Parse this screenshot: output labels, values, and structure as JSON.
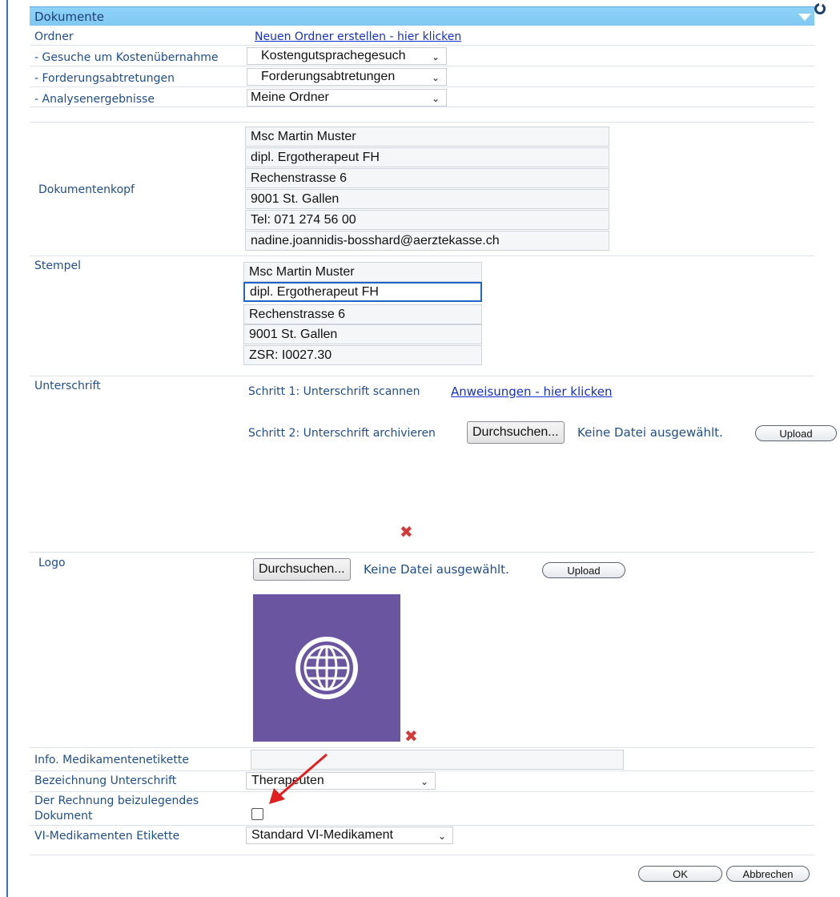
{
  "panel": {
    "title": "Dokumente"
  },
  "folders": {
    "label": "Ordner",
    "create_link": "Neuen Ordner erstellen - hier klicken",
    "rows": [
      {
        "label": "- Gesuche um Kostenübernahme",
        "value": "Kostengutsprachegesuch"
      },
      {
        "label": "- Forderungsabtretungen",
        "value": "Forderungsabtretungen"
      },
      {
        "label": "- Analysenergebnisse",
        "value": "Meine Ordner"
      }
    ]
  },
  "header_doc": {
    "label": "Dokumentenkopf",
    "lines": [
      "Msc Martin Muster",
      "dipl. Ergotherapeut FH",
      "Rechenstrasse 6",
      "9001 St. Gallen",
      "Tel: 071 274 56 00",
      "nadine.joannidis-bosshard@aerztekasse.ch"
    ]
  },
  "stamp": {
    "label": "Stempel",
    "lines": [
      "Msc Martin Muster",
      "dipl. Ergotherapeut FH",
      "Rechenstrasse 6",
      "9001 St. Gallen",
      "ZSR: I0027.30"
    ]
  },
  "signature": {
    "label": "Unterschrift",
    "step1_text": "Schritt 1: Unterschrift scannen",
    "step1_link": "Anweisungen - hier klicken",
    "step2_text": "Schritt 2: Unterschrift archivieren",
    "browse_label": "Durchsuchen...",
    "no_file": "Keine Datei ausgewählt.",
    "upload_label": "Upload"
  },
  "logo": {
    "label": "Logo",
    "browse_label": "Durchsuchen...",
    "no_file": "Keine Datei ausgewählt.",
    "upload_label": "Upload",
    "image_icon": "globe-icon",
    "image_color": "#6a55a0"
  },
  "medication_label_info": {
    "label": "Info. Medikamentenetikette",
    "value": ""
  },
  "signature_designation": {
    "label": "Bezeichnung Unterschrift",
    "value": "Therapeuten"
  },
  "invoice_document": {
    "label_line1": "Der Rechnung beizulegendes",
    "label_line2": "Dokument",
    "checked": false
  },
  "vi_label": {
    "label": "VI-Medikamenten Etikette",
    "value": "Standard VI-Medikament"
  },
  "actions": {
    "ok_label": "OK",
    "cancel_label": "Abbrechen"
  },
  "colors": {
    "header_bg": "#8fd3f7",
    "text": "#1f4e8c",
    "link": "#1530c9",
    "delete": "#d23b3b",
    "annotation_arrow": "#e02020"
  }
}
